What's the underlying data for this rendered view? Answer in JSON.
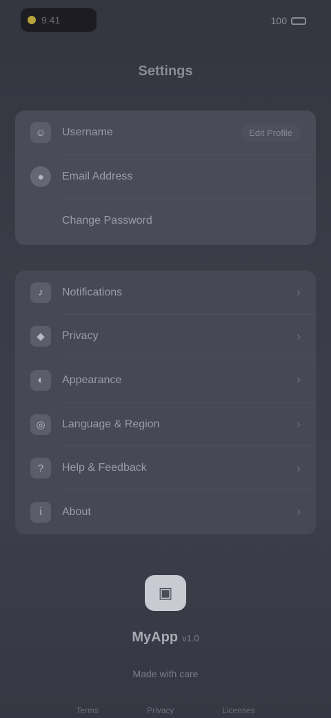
{
  "status_bar": {
    "time": "9:41",
    "battery_label": "100"
  },
  "header": {
    "title": "Settings"
  },
  "account_card": {
    "rows": [
      {
        "icon": "user-icon",
        "glyph": "☺",
        "label": "Username",
        "value": "Edit Profile"
      },
      {
        "icon": "avatar-icon",
        "glyph": "●",
        "label": "Email Address",
        "value": ""
      },
      {
        "icon": "",
        "glyph": "",
        "label": "Change Password",
        "value": ""
      }
    ]
  },
  "settings_list": {
    "items": [
      {
        "icon": "bell-icon",
        "glyph": "♪",
        "label": "Notifications"
      },
      {
        "icon": "lock-icon",
        "glyph": "◆",
        "label": "Privacy"
      },
      {
        "icon": "palette-icon",
        "glyph": "◐",
        "label": "Appearance"
      },
      {
        "icon": "globe-icon",
        "glyph": "◎",
        "label": "Language & Region"
      },
      {
        "icon": "help-icon",
        "glyph": "?",
        "label": "Help & Feedback"
      },
      {
        "icon": "info-icon",
        "glyph": "i",
        "label": "About"
      }
    ],
    "chevron": "›"
  },
  "footer": {
    "app_name": "MyApp",
    "version": "v1.0",
    "tagline": "Made with care",
    "links": [
      "Terms",
      "Privacy",
      "Licenses"
    ]
  },
  "colors": {
    "background": "#3a3b46",
    "card": "#474854",
    "accent_dot": "#b8a23a"
  }
}
